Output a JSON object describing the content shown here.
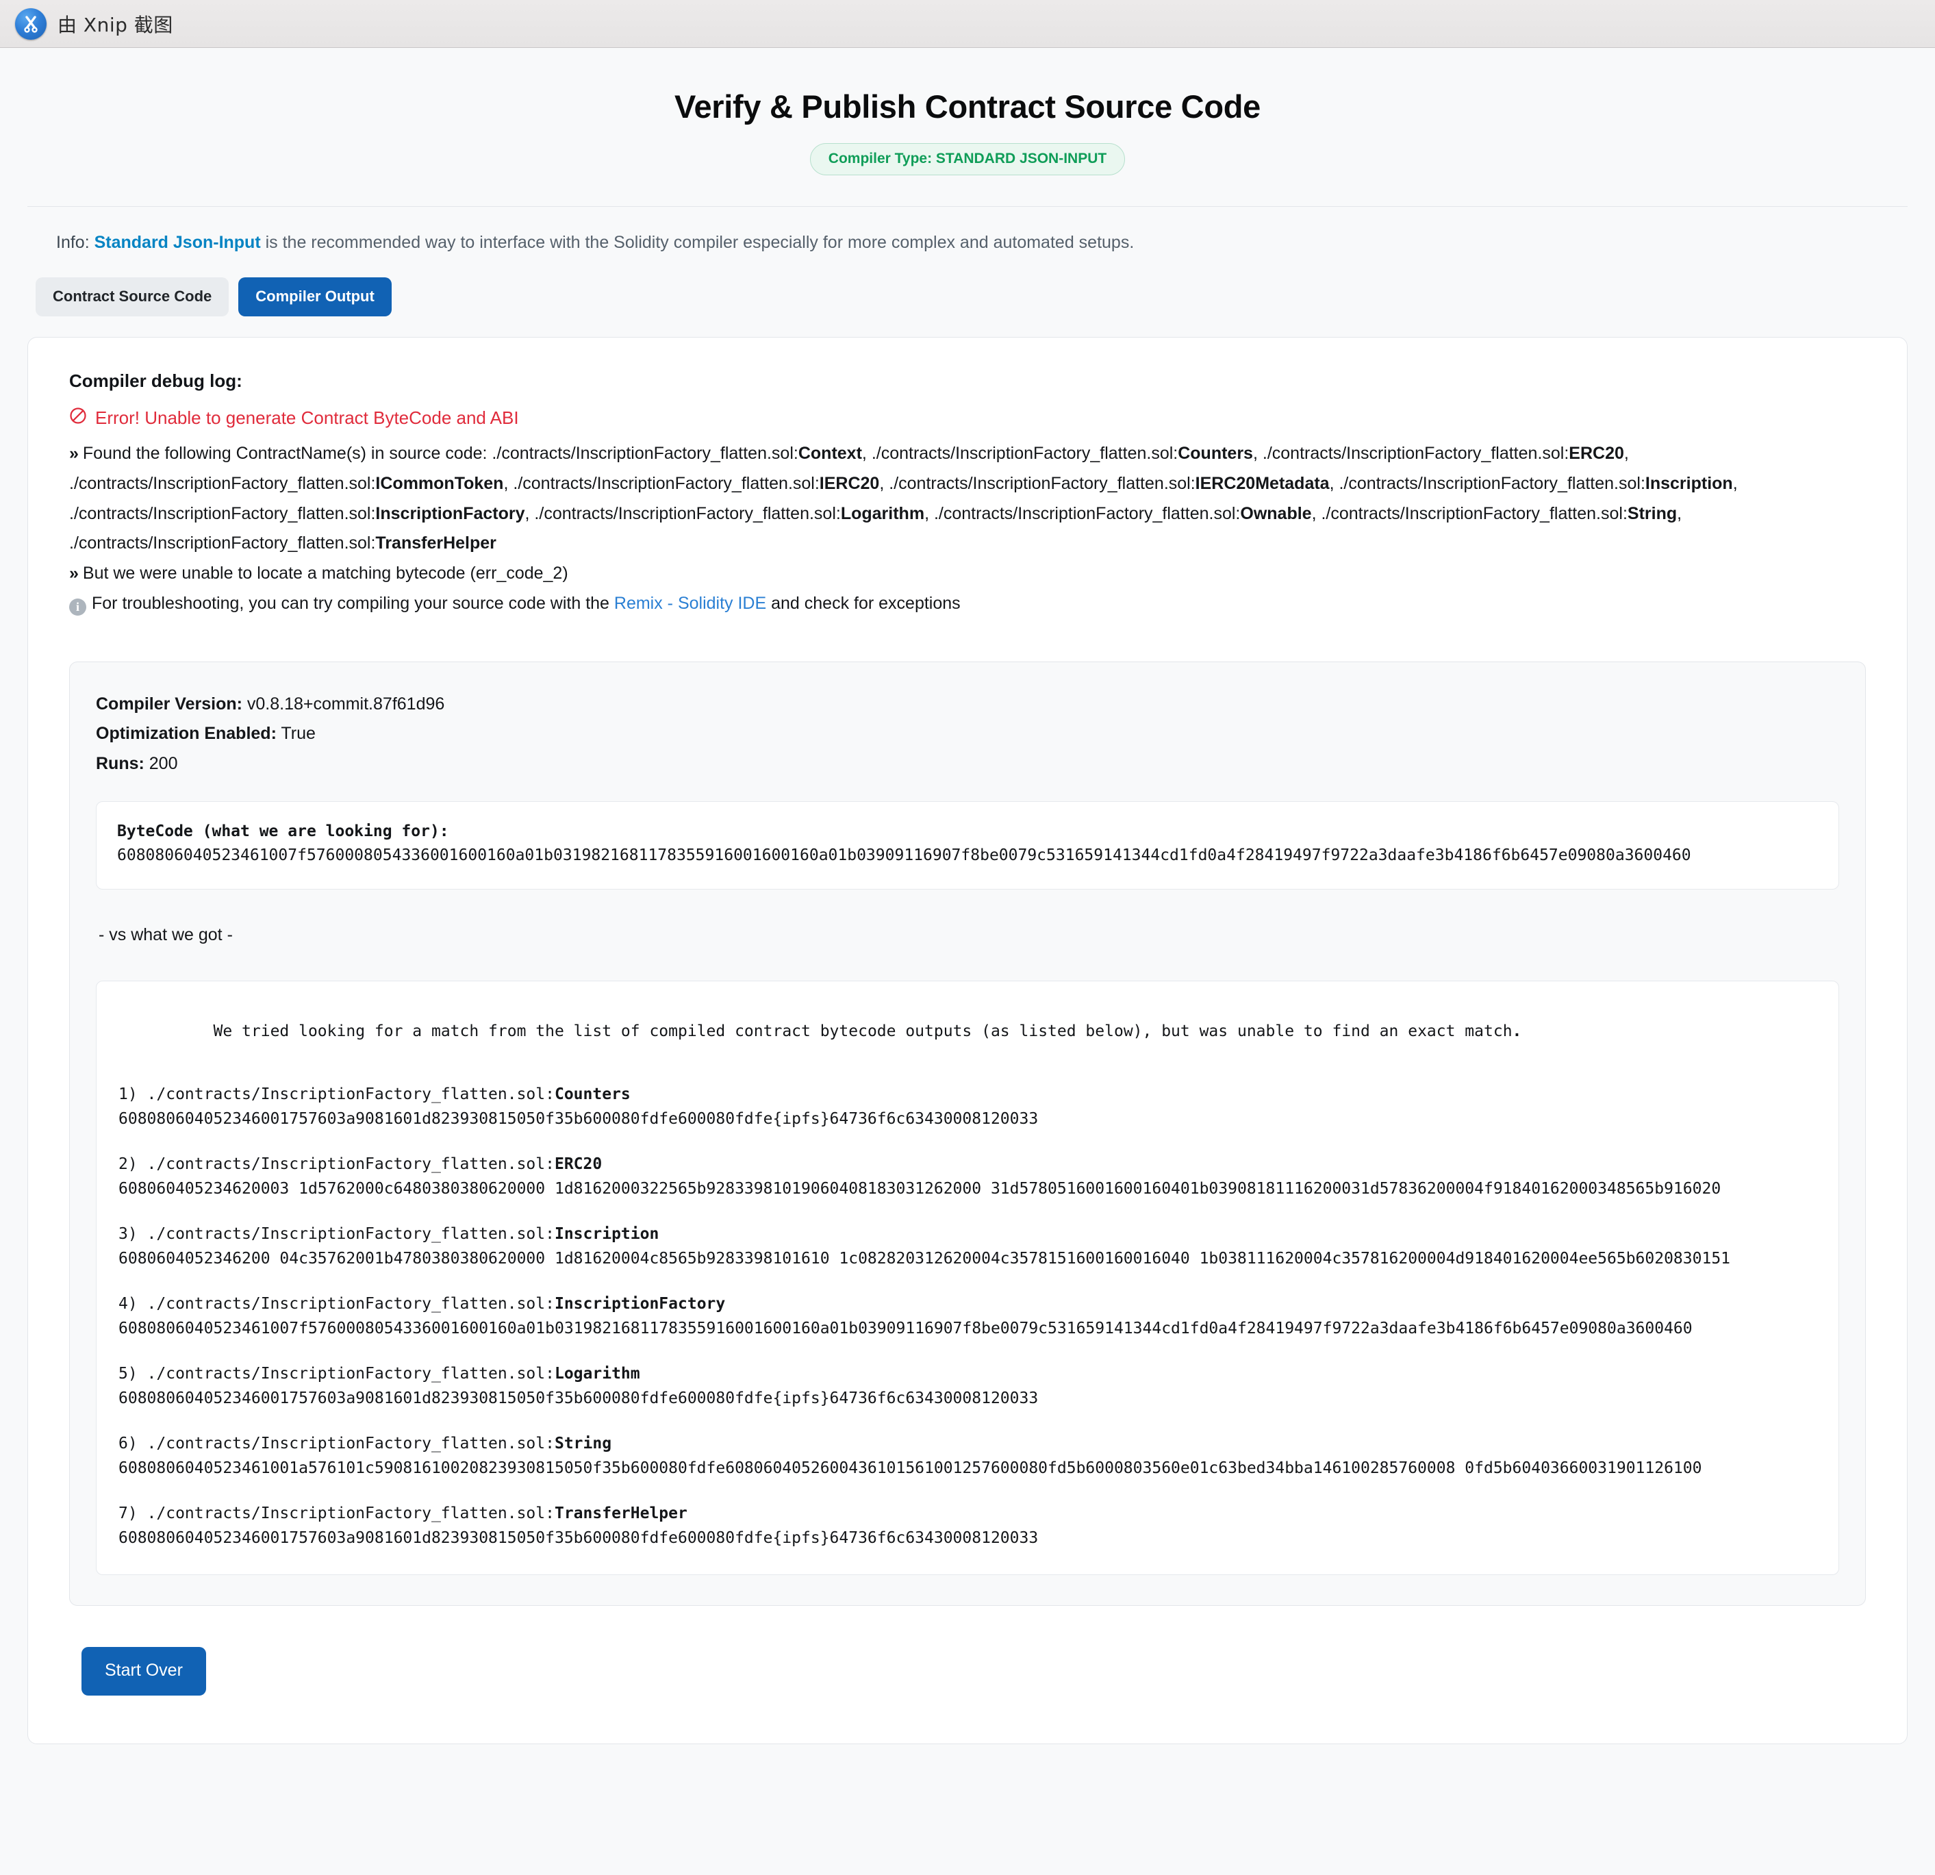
{
  "watermark": {
    "text": "由 Xnip 截图",
    "icon": "xnip-scissors-icon"
  },
  "header": {
    "title": "Verify & Publish Contract Source Code",
    "badge": "Compiler Type: STANDARD JSON-INPUT",
    "badge_color": "#0f9d58"
  },
  "info": {
    "prefix": "Info: ",
    "link": "Standard Json-Input",
    "suffix": " is the recommended way to interface with the Solidity compiler especially for more complex and automated setups."
  },
  "tabs": [
    {
      "label": "Contract Source Code",
      "active": false
    },
    {
      "label": "Compiler Output",
      "active": true
    }
  ],
  "debug": {
    "title": "Compiler debug log:",
    "error": "Error! Unable to generate Contract ByteCode and ABI",
    "error_color": "#e02b3b",
    "found_prefix": "Found the following ContractName(s) in source code: ",
    "file_prefix": "./contracts/InscriptionFactory_flatten.sol:",
    "contract_names": [
      "Context",
      "Counters",
      "ERC20",
      "ICommonToken",
      "IERC20",
      "IERC20Metadata",
      "Inscription",
      "InscriptionFactory",
      "Logarithm",
      "Ownable",
      "String",
      "TransferHelper"
    ],
    "unable_line": "But we were unable to locate a matching bytecode (err_code_2)",
    "troubleshoot_prefix": "For troubleshooting, you can try compiling your source code with the ",
    "troubleshoot_link": "Remix - Solidity IDE",
    "troubleshoot_suffix": " and check for exceptions"
  },
  "meta": {
    "compiler_version_label": "Compiler Version:",
    "compiler_version_value": " v0.8.18+commit.87f61d96",
    "optimization_label": "Optimization Enabled:",
    "optimization_value": " True",
    "runs_label": "Runs:",
    "runs_value": " 200"
  },
  "bytecode": {
    "heading": "ByteCode (what we are looking for):",
    "hex": "6080806040523461007f5760008054336001600160a01b0319821681178355916001600160a01b03909116907f8be0079c531659141344cd1fd0a4f28419497f9722a3daafe3b4186f6b6457e09080a3600460"
  },
  "vs_text": "- vs what we got -",
  "got": {
    "intro_prefix": "We tried looking for a match from the list of compiled contract bytecode outputs (as listed below), but was unable to find an exact match",
    "intro_suffix": ".",
    "file_prefix": "./contracts/InscriptionFactory_flatten.sol:",
    "entries": [
      {
        "num": "1) ",
        "name": "Counters",
        "hex": "608080604052346001757603a9081601d823930815050f35b600080fdfe600080fdfe{ipfs}64736f6c63430008120033"
      },
      {
        "num": "2) ",
        "name": "ERC20",
        "hex": "608060405234620003 1d5762000c6480380380620000 1d8162000322565b92833981019060408183031262000 31d5780516001600160401b03908181116200031d57836200004f91840162000348565b916020"
      },
      {
        "num": "3) ",
        "name": "Inscription",
        "hex": "6080604052346200 04c35762001b4780380380620000 1d81620004c8565b9283398101610 1c082820312620004c3578151600160016040 1b038111620004c357816200004d918401620004ee565b6020830151"
      },
      {
        "num": "4) ",
        "name": "InscriptionFactory",
        "hex": "6080806040523461007f5760008054336001600160a01b0319821681178355916001600160a01b03909116907f8be0079c531659141344cd1fd0a4f28419497f9722a3daafe3b4186f6b6457e09080a3600460"
      },
      {
        "num": "5) ",
        "name": "Logarithm",
        "hex": "608080604052346001757603a9081601d823930815050f35b600080fdfe600080fdfe{ipfs}64736f6c63430008120033"
      },
      {
        "num": "6) ",
        "name": "String",
        "hex": "6080806040523461001a576101c59081610020823930815050f35b600080fdfe6080604052600436101561001257600080fd5b6000803560e01c63bed34bba146100285760008 0fd5b60403660031901126100"
      },
      {
        "num": "7) ",
        "name": "TransferHelper",
        "hex": "608080604052346001757603a9081601d823930815050f35b600080fdfe600080fdfe{ipfs}64736f6c63430008120033"
      }
    ]
  },
  "footer": {
    "start_over": "Start Over"
  }
}
